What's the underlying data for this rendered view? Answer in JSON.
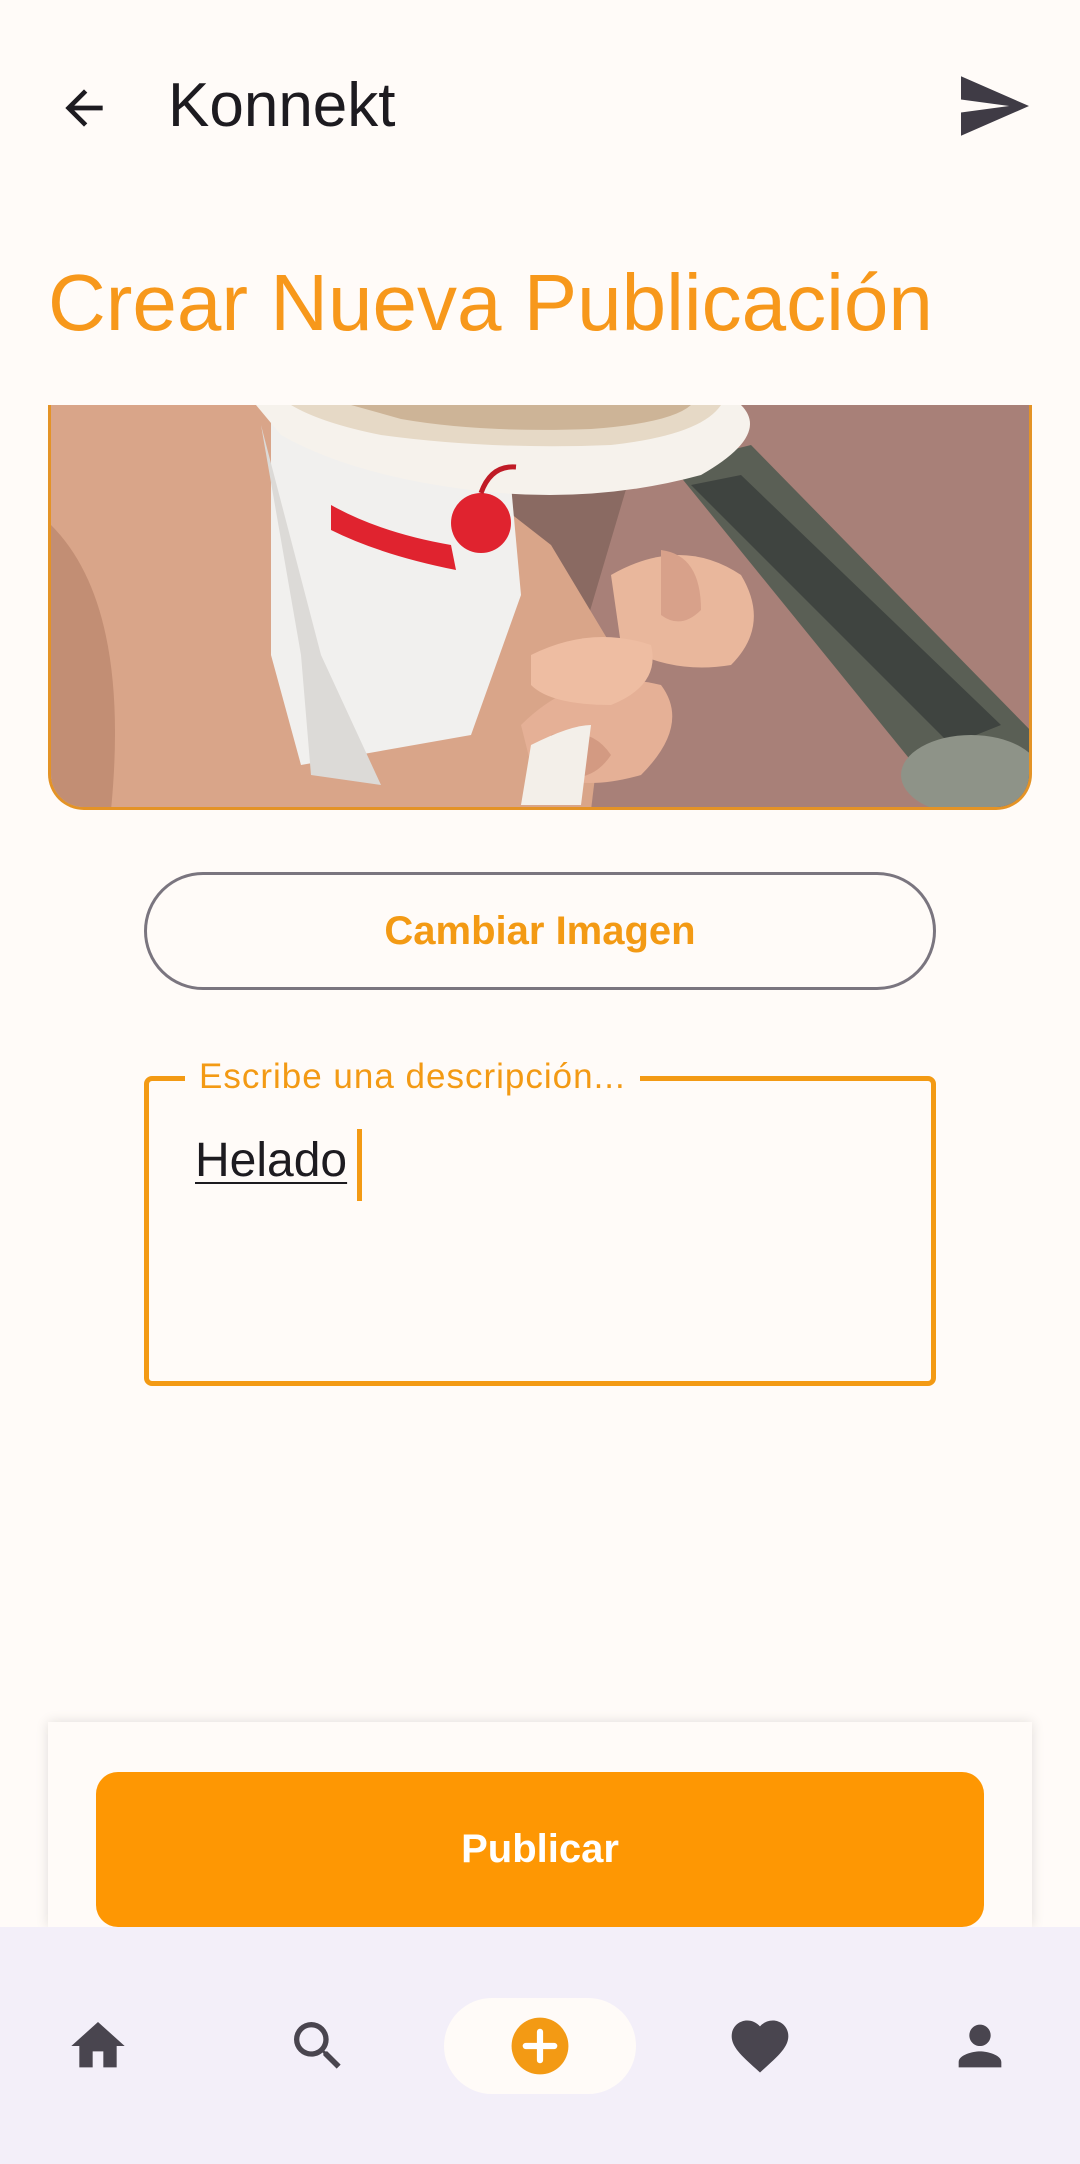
{
  "app": {
    "title": "Konnekt",
    "back_icon": "arrow-back-icon",
    "send_icon": "send-icon"
  },
  "page": {
    "title": "Crear Nueva Publicación"
  },
  "image": {
    "change_label": "Cambiar Imagen",
    "content": "photo of a hand holding an ice cream cup"
  },
  "description": {
    "label": "Escribe una descripción...",
    "value": "Helado"
  },
  "actions": {
    "publish_label": "Publicar"
  },
  "nav": {
    "items": [
      {
        "icon": "home-icon",
        "active": false
      },
      {
        "icon": "search-icon",
        "active": false
      },
      {
        "icon": "add-icon",
        "active": true
      },
      {
        "icon": "heart-icon",
        "active": false
      },
      {
        "icon": "person-icon",
        "active": false
      }
    ]
  },
  "colors": {
    "accent": "#f39a14",
    "publish": "#fe9703",
    "background": "#fffbf8",
    "nav_background": "#f3eff9",
    "icon_dark": "#49454f"
  }
}
